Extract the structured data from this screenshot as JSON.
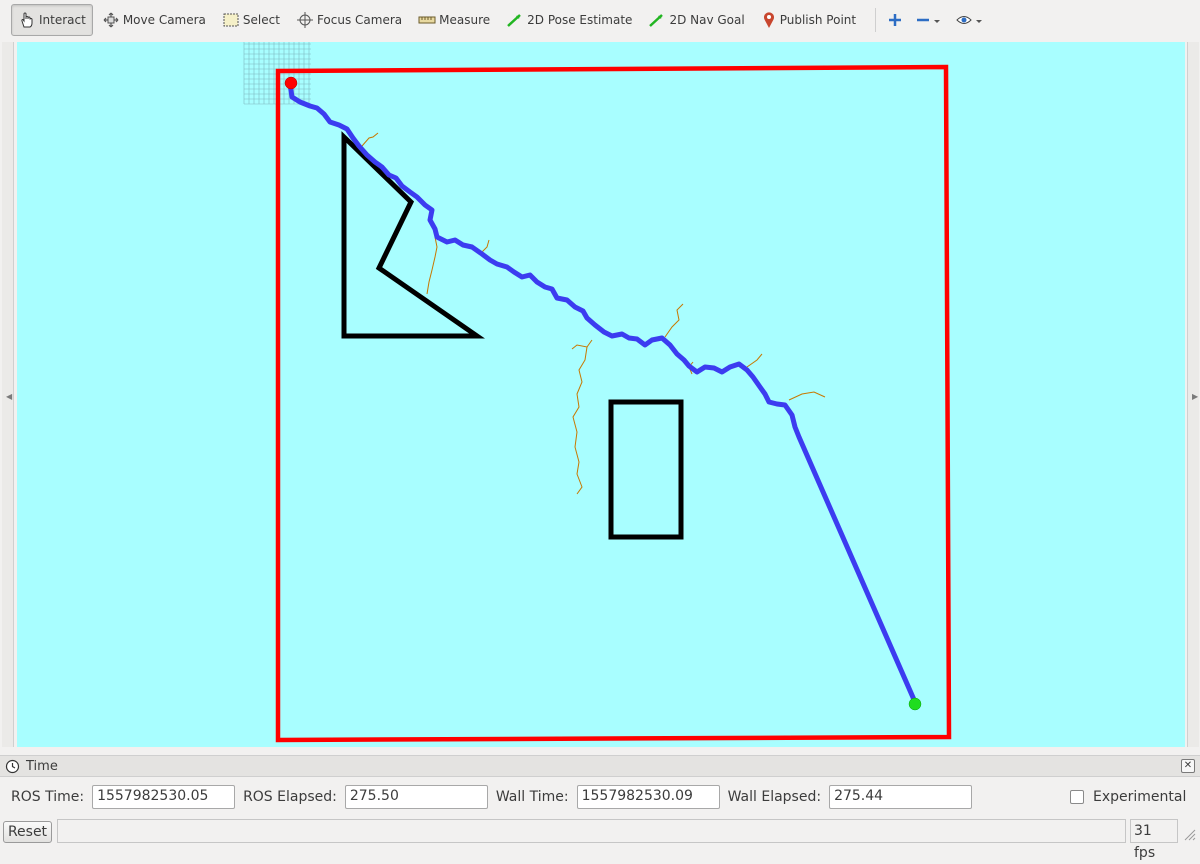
{
  "toolbar": {
    "tools": [
      {
        "label": "Interact",
        "icon": "hand-icon",
        "active": true
      },
      {
        "label": "Move Camera",
        "icon": "move-camera-icon"
      },
      {
        "label": "Select",
        "icon": "select-icon"
      },
      {
        "label": "Focus Camera",
        "icon": "crosshair-icon"
      },
      {
        "label": "Measure",
        "icon": "ruler-icon"
      },
      {
        "label": "2D Pose Estimate",
        "icon": "green-arrow-icon"
      },
      {
        "label": "2D Nav Goal",
        "icon": "green-arrow-icon"
      },
      {
        "label": "Publish Point",
        "icon": "map-pin-icon"
      }
    ],
    "extra_icons": [
      "plus-icon",
      "minus-icon",
      "eye-icon"
    ]
  },
  "viewport": {
    "background_color": "#a8feff",
    "boundary_color": "#ff0000",
    "path_color": "#3c3cf0",
    "obstacle_color": "#000000",
    "tree_color": "#c87800",
    "start_color": "#ff0000",
    "goal_color": "#00dd00"
  },
  "time_panel": {
    "title": "Time",
    "ros_time_label": "ROS Time:",
    "ros_time": "1557982530.05",
    "ros_elapsed_label": "ROS Elapsed:",
    "ros_elapsed": "275.50",
    "wall_time_label": "Wall Time:",
    "wall_time": "1557982530.09",
    "wall_elapsed_label": "Wall Elapsed:",
    "wall_elapsed": "275.44",
    "experimental_label": "Experimental"
  },
  "status": {
    "reset_label": "Reset",
    "fps": "31 fps"
  }
}
